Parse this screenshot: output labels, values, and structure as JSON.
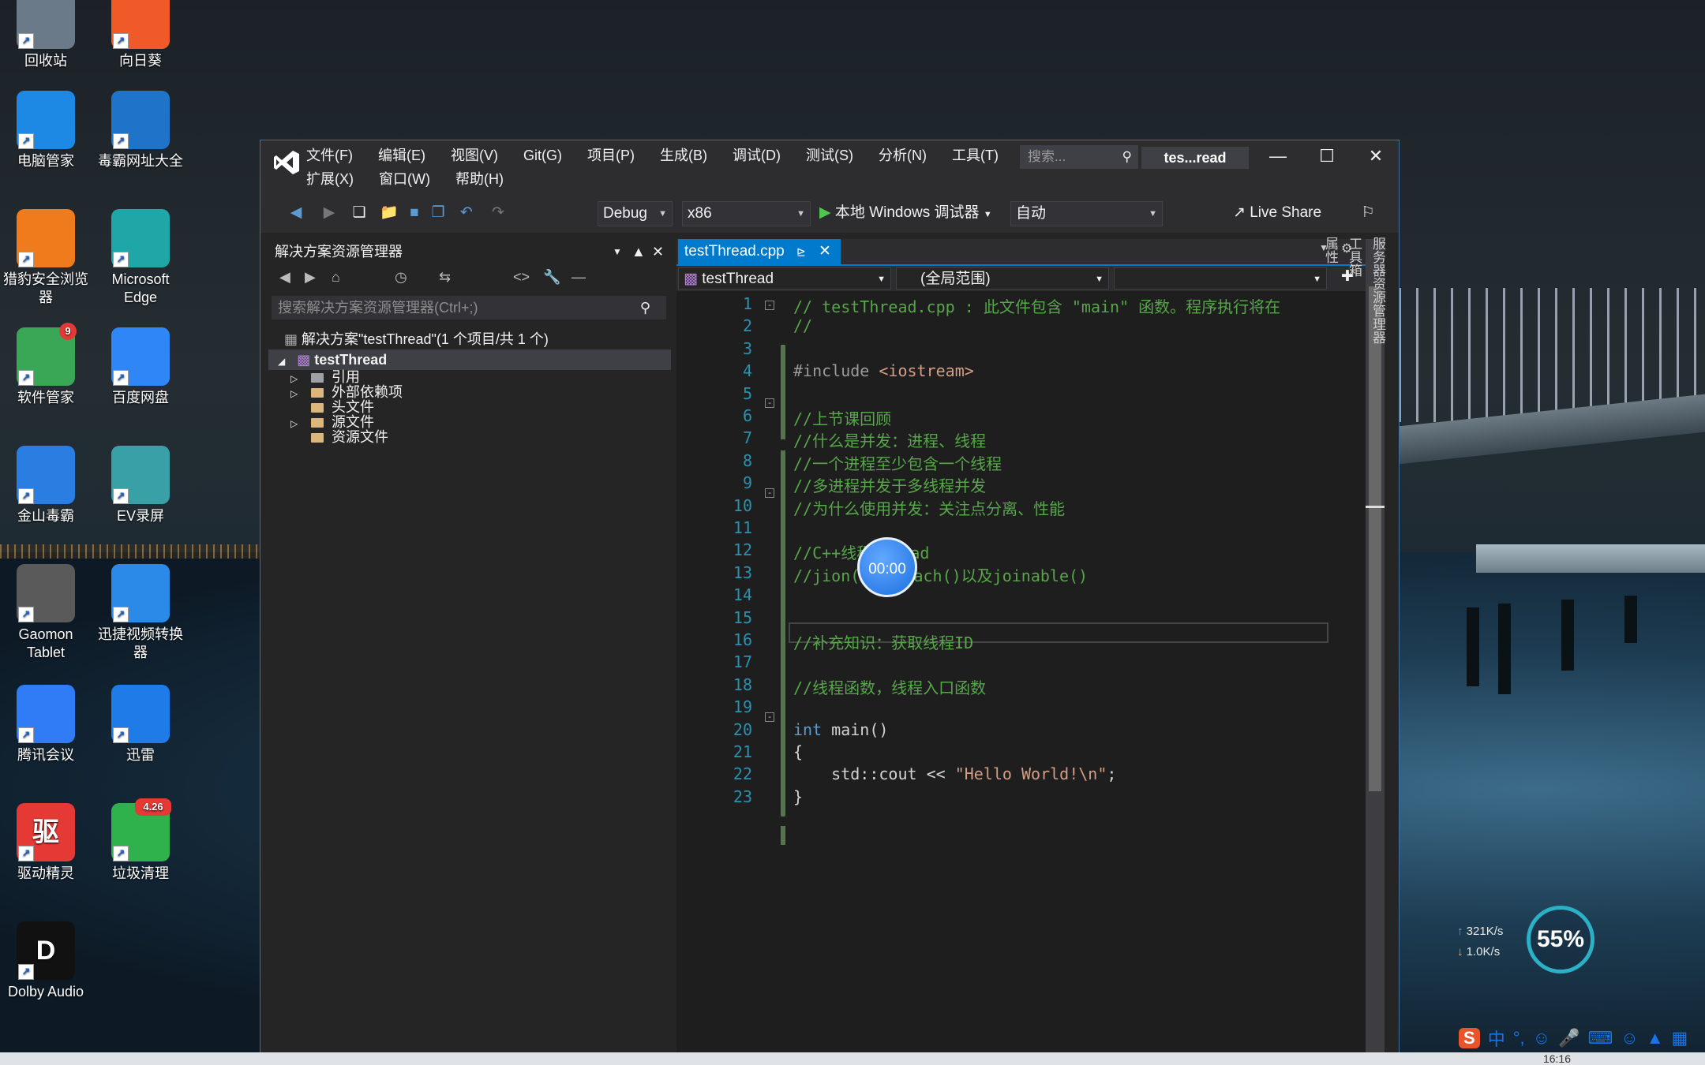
{
  "desktop": {
    "icons": [
      {
        "label": "回收站",
        "icon": "recycle-bin-icon",
        "color": "#6a7a88"
      },
      {
        "label": "向日葵",
        "icon": "sunflower-icon",
        "color": "#f05a28"
      },
      {
        "label": "电脑管家",
        "icon": "pc-manager-icon",
        "color": "#1e88e5"
      },
      {
        "label": "毒霸网址大全",
        "icon": "ie-browser-icon",
        "color": "#1f73c9"
      },
      {
        "label": "猎豹安全浏览器",
        "icon": "cheetah-browser-icon",
        "color": "#ef7b1c"
      },
      {
        "label": "Microsoft Edge",
        "icon": "edge-icon",
        "color": "#1fa6a6"
      },
      {
        "label": "软件管家",
        "icon": "software-manager-icon",
        "color": "#3aa757",
        "badge": "9"
      },
      {
        "label": "百度网盘",
        "icon": "baidu-netdisk-icon",
        "color": "#2f86f6"
      },
      {
        "label": "金山毒霸",
        "icon": "duba-antivirus-icon",
        "color": "#2a7de1"
      },
      {
        "label": "EV录屏",
        "icon": "ev-recorder-icon",
        "color": "#39a0a8"
      },
      {
        "label": "Gaomon Tablet",
        "icon": "gaomon-icon",
        "color": "#5a5a5a"
      },
      {
        "label": "迅捷视频转换器",
        "icon": "video-converter-icon",
        "color": "#2b8ae8"
      },
      {
        "label": "腾讯会议",
        "icon": "tencent-meeting-icon",
        "color": "#2f7cf6"
      },
      {
        "label": "迅雷",
        "icon": "thunder-icon",
        "color": "#1f7be8"
      },
      {
        "label": "驱动精灵",
        "icon": "driver-genius-icon",
        "color": "#e53935",
        "glyph": "驱"
      },
      {
        "label": "垃圾清理",
        "icon": "trash-cleanup-icon",
        "color": "#2fb24c",
        "badge": "4.26"
      },
      {
        "label": "Dolby Audio",
        "icon": "dolby-icon",
        "color": "#111111",
        "glyph": "D"
      }
    ]
  },
  "vs": {
    "menu_row1": [
      "文件(F)",
      "编辑(E)",
      "视图(V)",
      "Git(G)",
      "项目(P)",
      "生成(B)",
      "调试(D)",
      "测试(S)",
      "分析(N)",
      "工具(T)"
    ],
    "menu_row2": [
      "扩展(X)",
      "窗口(W)",
      "帮助(H)"
    ],
    "search_placeholder": "搜索...",
    "window_title": "tes...read",
    "toolbar": {
      "config": "Debug",
      "platform": "x86",
      "run_label": "本地 Windows 调试器",
      "auto": "自动",
      "live_share": "Live Share"
    },
    "solution_explorer": {
      "title": "解决方案资源管理器",
      "search_placeholder": "搜索解决方案资源管理器(Ctrl+;)",
      "solution": "解决方案\"testThread\"(1 个项目/共 1 个)",
      "project": "testThread",
      "nodes": [
        "引用",
        "外部依赖项",
        "头文件",
        "源文件",
        "资源文件"
      ]
    },
    "editor": {
      "tab": "testThread.cpp",
      "nav_project": "testThread",
      "nav_scope": "(全局范围)",
      "lines": [
        "// testThread.cpp : 此文件包含 \"main\" 函数。程序执行将在",
        "//",
        "",
        "#include <iostream>",
        "",
        "//上节课回顾",
        "//什么是并发：进程、线程",
        "//一个进程至少包含一个线程",
        "//多进程并发于多线程并发",
        "//为什么使用并发：关注点分离、性能",
        "",
        "//C++线程thread",
        "//jion()、detach()以及joinable()",
        "",
        "",
        "//补充知识：获取线程ID",
        "",
        "//线程函数，线程入口函数",
        "",
        "int main()",
        "{",
        "    std::cout << \"Hello World!\\n\";",
        "}"
      ]
    },
    "side_panel": [
      "服务器资源管理器",
      "工具箱",
      "属性"
    ]
  },
  "overlay": {
    "timer": "00:00",
    "net_up": "321K/s",
    "net_down": "1.0K/s",
    "usage": "55%"
  },
  "tray": {
    "ime": "中",
    "clock": "16:16"
  }
}
